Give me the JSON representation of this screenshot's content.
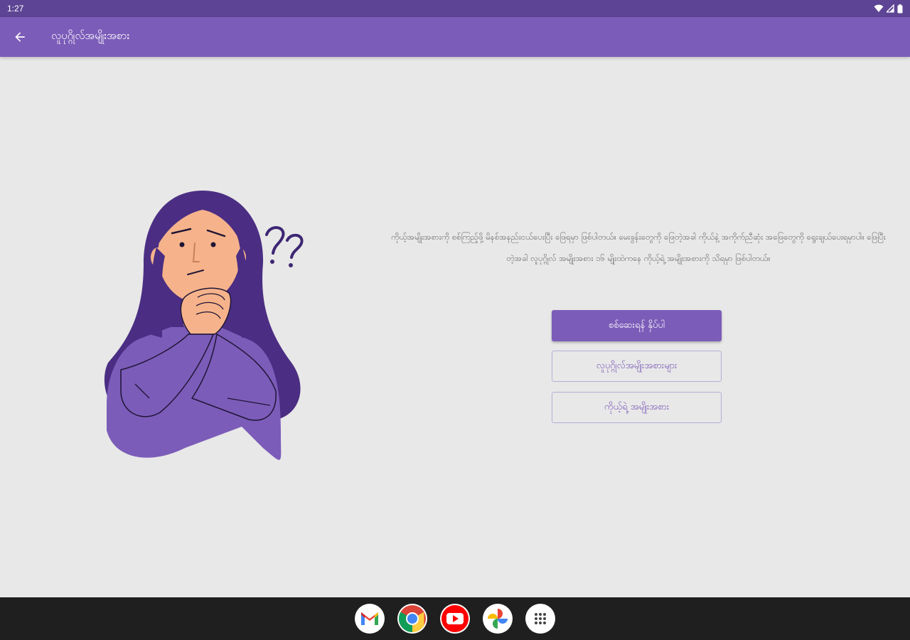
{
  "status_bar": {
    "time": "1:27"
  },
  "app_bar": {
    "title": "လူပုဂ္ဂိုလ်အမျိုးအစား",
    "back_icon": "arrow-left-icon"
  },
  "main": {
    "description": "ကိုယ့်အမျိုးအစားကို စစ်ကြည့်ဖို့ မိနစ်အနည်းငယ်ပေးပြီး ဖြေရမှာ ဖြစ်ပါတယ်။ မေးခွန်းတွေကို ဖြေတဲ့အခါ ကိုယ်နဲ့ အကိုက်ညီဆုံး အဖြေတွေကို ရွေးချယ်ပေးရမှာပါ။ ဖြေပြီးတဲ့အခါ လူပုဂ္ဂိုလ် အမျိုးအစား ၁၆ မျိုးထဲကနေ ကိုယ့်ရဲ့ အမျိုးအစားကို သိရမှာ ဖြစ်ပါတယ်။",
    "buttons": {
      "start": "စစ်ဆေးရန် နှိပ်ပါ",
      "types": "လူပုဂ္ဂိုလ်အမျိုးအစားများ",
      "my_type": "ကိုယ့်ရဲ့ အမျိုးအစား"
    }
  },
  "dock": {
    "apps": [
      "gmail-icon",
      "chrome-icon",
      "youtube-icon",
      "photos-icon",
      "app-drawer-icon"
    ]
  },
  "colors": {
    "primary": "#7c5cb9",
    "status_bar": "#5d4494",
    "background": "#e8e8e8",
    "nav_bar": "#1f1f1f"
  }
}
